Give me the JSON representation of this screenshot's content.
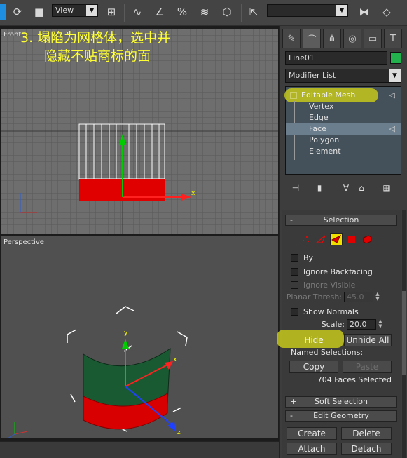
{
  "toolbar": {
    "view_select": "View"
  },
  "viewports": {
    "front_label": "Front",
    "persp_label": "Perspective",
    "annotation_line1": "3.  塌陷为网格体，选中并",
    "annotation_line2": "隐藏不贴商标的面",
    "axis_x": "x",
    "axis_y": "y",
    "axis_z": "z"
  },
  "command_panel": {
    "object_name": "Line01",
    "object_color": "#22b14c",
    "modifier_list": "Modifier List",
    "stack": {
      "top": "Editable Mesh",
      "items": [
        "Vertex",
        "Edge",
        "Face",
        "Polygon",
        "Element"
      ],
      "selected": "Face"
    },
    "selection_rollout": {
      "title": "Selection",
      "by": "By",
      "ignore_backfacing": "Ignore Backfacing",
      "ignore_visible": "Ignore Visible",
      "planar_thresh_label": "Planar Thresh:",
      "planar_thresh_value": "45.0",
      "show_normals": "Show Normals",
      "scale_label": "Scale:",
      "scale_value": "20.0",
      "hide": "Hide",
      "unhide_all": "Unhide All",
      "named_selections": "Named Selections:",
      "copy": "Copy",
      "paste": "Paste",
      "status": "704 Faces Selected"
    },
    "soft_selection": "Soft Selection",
    "edit_geometry": {
      "title": "Edit Geometry",
      "create": "Create",
      "delete": "Delete",
      "attach": "Attach",
      "detach": "Detach"
    }
  },
  "colors": {
    "highlight": "#c6c81c",
    "annotation": "#ffff33",
    "mesh_red": "#e00000",
    "mesh_green": "#1a5a32"
  }
}
